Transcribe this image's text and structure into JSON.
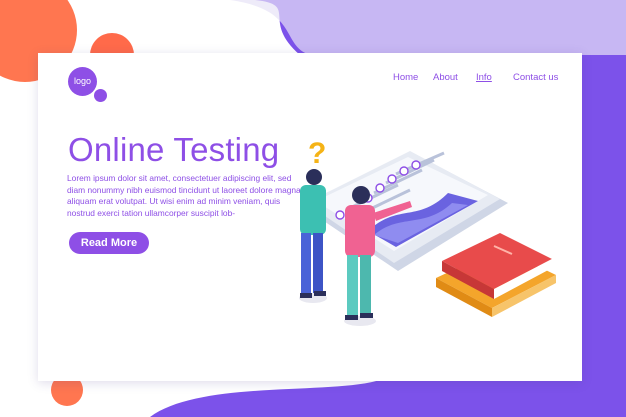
{
  "brand": {
    "logo_text": "logo"
  },
  "nav": {
    "items": [
      {
        "label": "Home",
        "active": false
      },
      {
        "label": "About",
        "active": false
      },
      {
        "label": "Info",
        "active": true
      },
      {
        "label": "Contact us",
        "active": false
      }
    ]
  },
  "hero": {
    "title": "Online Testing",
    "body": "Lorem ipsum dolor sit amet, consectetuer adipiscing elit, sed diam nonummy nibh euismod tincidunt ut laoreet dolore magna aliquam erat volutpat. Ut wisi enim ad minim veniam, quis nostrud exerci tation ullamcorper suscipit lob-",
    "cta_label": "Read More"
  },
  "colors": {
    "accent": "#8e4fe6",
    "background_blob": "#7b52e8",
    "orange": "#ff7a55"
  }
}
